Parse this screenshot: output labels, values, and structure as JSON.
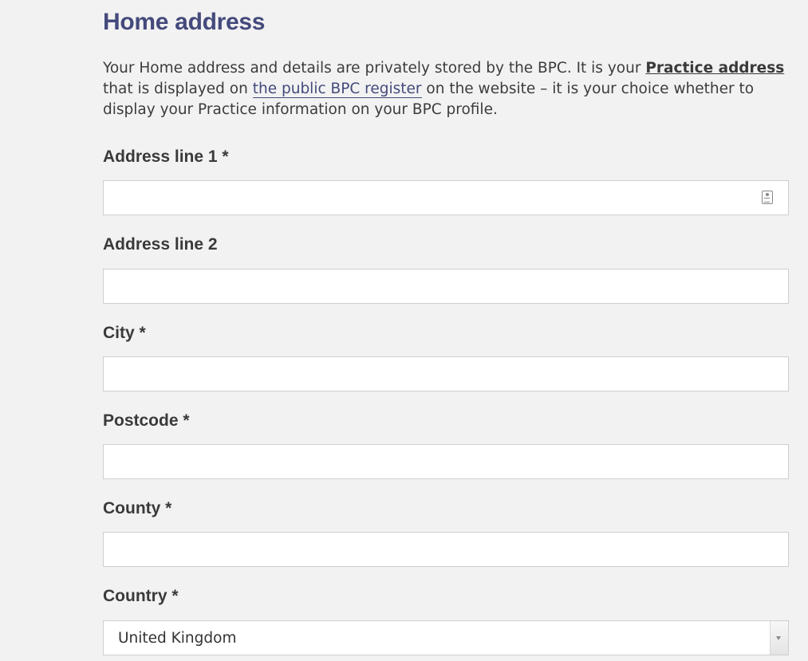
{
  "section": {
    "title": "Home address"
  },
  "intro": {
    "text_before": "Your Home address and details are privately stored by the BPC. It is your ",
    "practice_address": "Practice address",
    "text_middle": " that is displayed on ",
    "register_link": "the public BPC register",
    "text_after": " on the website – it is your choice whether to display your Practice information on your BPC profile."
  },
  "fields": {
    "address_line_1": {
      "label": "Address line 1 *",
      "value": ""
    },
    "address_line_2": {
      "label": "Address line 2",
      "value": ""
    },
    "city": {
      "label": "City *",
      "value": ""
    },
    "postcode": {
      "label": "Postcode *",
      "value": ""
    },
    "county": {
      "label": "County *",
      "value": ""
    },
    "country": {
      "label": "Country *",
      "selected": "United Kingdom"
    }
  },
  "icons": {
    "autofill": "contact-card-icon",
    "dropdown": "chevron-down-icon"
  }
}
